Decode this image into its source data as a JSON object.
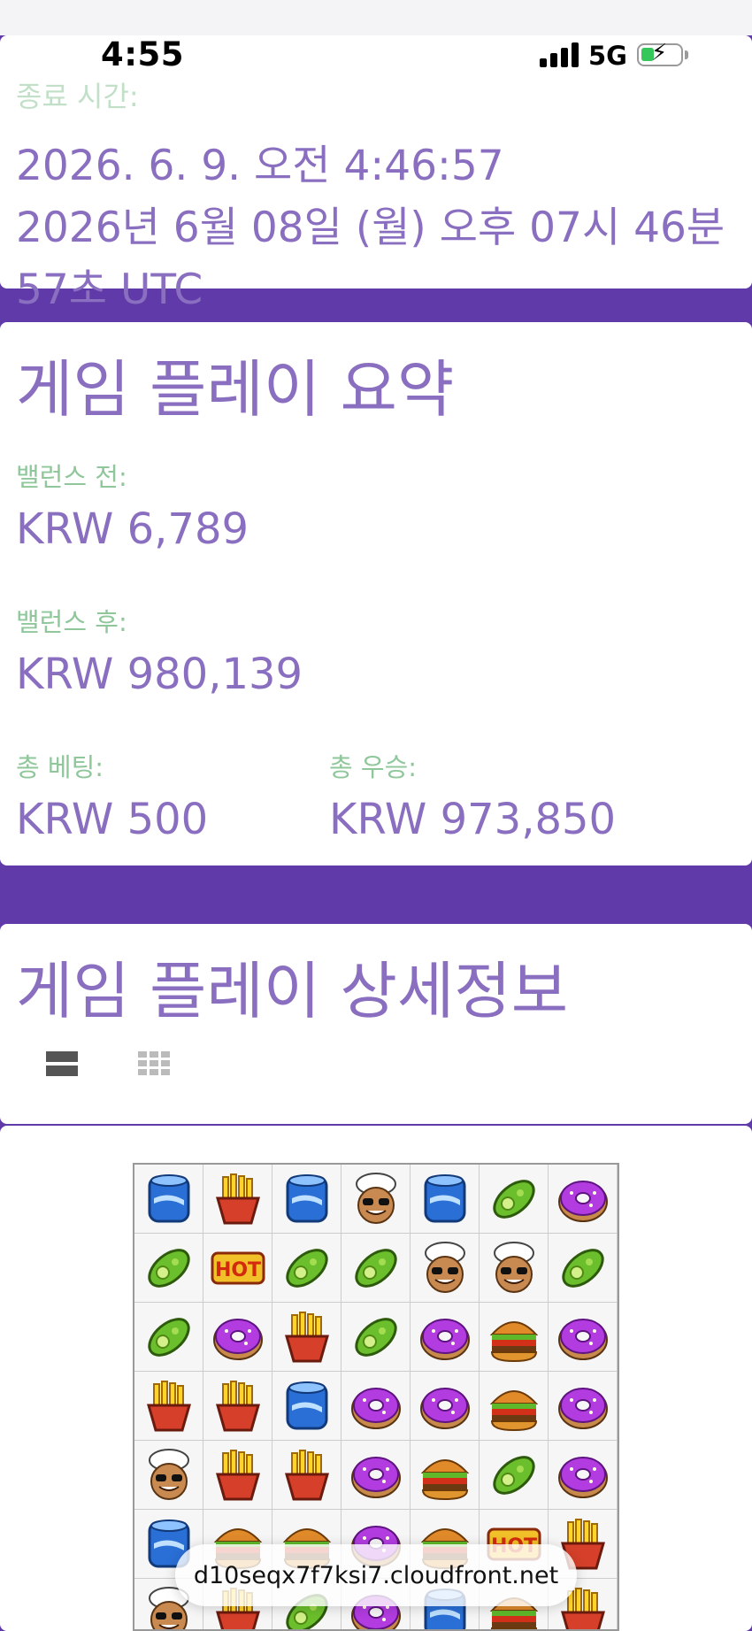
{
  "status_bar": {
    "time": "4:55",
    "network": "5G"
  },
  "end_time": {
    "label": "종료 시간:",
    "line1": "2026. 6. 9. 오전 4:46:57",
    "line2": "2026년 6월 08일 (월) 오후 07시 46분",
    "line3": "57초 UTC"
  },
  "summary": {
    "title": "게임 플레이 요약",
    "balance_before_label": "밸런스 전:",
    "balance_before": "KRW 6,789",
    "balance_after_label": "밸런스 후:",
    "balance_after": "KRW 980,139",
    "total_bet_label": "총 베팅:",
    "total_bet": "KRW 500",
    "total_win_label": "총 우승:",
    "total_win": "KRW 973,850"
  },
  "details": {
    "title": "게임 플레이 상세정보",
    "views": [
      "list-view-icon",
      "grid-view-icon"
    ]
  },
  "board": {
    "rows": [
      [
        "soda",
        "fries",
        "soda",
        "chef",
        "soda",
        "pickle",
        "donut"
      ],
      [
        "pickle",
        "hot",
        "pickle",
        "pickle",
        "chef",
        "chef",
        "pickle"
      ],
      [
        "pickle",
        "donut",
        "fries",
        "pickle",
        "donut",
        "burger",
        "donut"
      ],
      [
        "fries",
        "fries",
        "soda",
        "donut",
        "donut",
        "burger",
        "donut"
      ],
      [
        "chef",
        "fries",
        "fries",
        "donut",
        "burger",
        "pickle",
        "donut"
      ],
      [
        "soda",
        "burger",
        "burger",
        "donut",
        "burger",
        "hot",
        "fries"
      ],
      [
        "chef",
        "fries",
        "pickle",
        "donut",
        "soda",
        "burger",
        "fries"
      ]
    ],
    "hot_text": "HOT"
  },
  "browser": {
    "url": "d10seqx7f7ksi7.cloudfront.net"
  },
  "colors": {
    "background": "#5f3aa8",
    "heading": "#8a6fc0",
    "label_green": "#8fc79b",
    "card": "#ffffff"
  }
}
